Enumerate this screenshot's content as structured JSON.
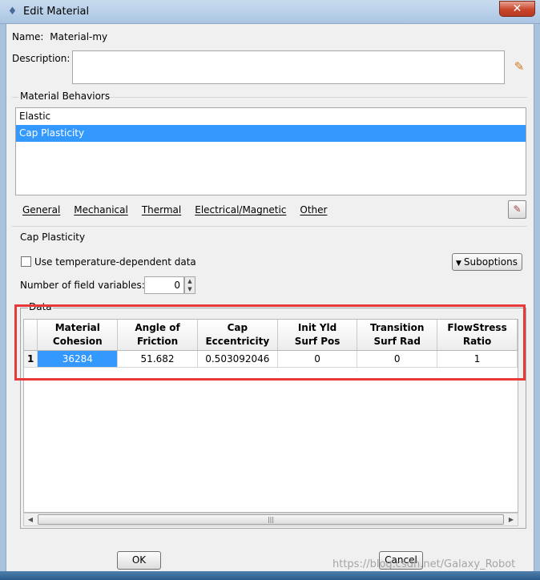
{
  "window": {
    "title": "Edit Material",
    "close_label": "✕"
  },
  "name_row": {
    "label": "Name:",
    "value": "Material-my"
  },
  "description": {
    "label": "Description:",
    "value": ""
  },
  "material_behaviors": {
    "label": "Material Behaviors",
    "items": [
      {
        "label": "Elastic",
        "selected": false
      },
      {
        "label": "Cap Plasticity",
        "selected": true
      }
    ]
  },
  "menu": {
    "items": [
      "General",
      "Mechanical",
      "Thermal",
      "Electrical/Magnetic",
      "Other"
    ]
  },
  "cap_plasticity": {
    "label": "Cap Plasticity",
    "temp_dependent_label": "Use temperature-dependent data",
    "temp_dependent_checked": false,
    "suboptions_label": "Suboptions",
    "field_vars_label": "Number of field variables:",
    "field_vars_value": "0"
  },
  "data": {
    "label": "Data",
    "columns": [
      {
        "line1": "Material",
        "line2": "Cohesion"
      },
      {
        "line1": "Angle of",
        "line2": "Friction"
      },
      {
        "line1": "Cap",
        "line2": "Eccentricity"
      },
      {
        "line1": "Init Yld",
        "line2": "Surf Pos"
      },
      {
        "line1": "Transition",
        "line2": "Surf Rad"
      },
      {
        "line1": "FlowStress",
        "line2": "Ratio"
      }
    ],
    "rows": [
      {
        "num": "1",
        "cells": [
          "36284",
          "51.682",
          "0.503092046",
          "0",
          "0",
          "1"
        ]
      }
    ]
  },
  "buttons": {
    "ok": "OK",
    "cancel": "Cancel"
  },
  "watermark": "https://blog.csdn.net/Galaxy_Robot",
  "colors": {
    "selection": "#3399ff",
    "highlight_box": "#e8393b",
    "icon_pencil": "#d07a1e"
  }
}
